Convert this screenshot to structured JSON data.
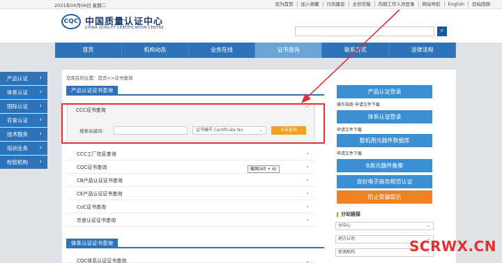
{
  "top": {
    "date": "2021年04月06日 星期二",
    "links": [
      "设为首页",
      "加入收藏",
      "行风建设",
      "主任信箱",
      "内部工作人员登录",
      "网站导航",
      "English",
      "旧站回顾"
    ]
  },
  "logo": {
    "mark": "CQC",
    "cn": "中国质量认证中心",
    "en": "CHINA QUALITY CERTIFICATION CENTRE"
  },
  "search": {
    "icon": "search-icon"
  },
  "nav": [
    "首页",
    "机构动态",
    "业务在线",
    "证书查询",
    "联系方式",
    "法律法规"
  ],
  "sidebar": [
    "产品认证",
    "体系认证",
    "国际认证",
    "农食认证",
    "技术服务",
    "培训业务",
    "检验机构"
  ],
  "main": {
    "breadcrumb": "您现在的位置：首页>>证书查询",
    "section1": "产品认证证书查询",
    "open_item": "CCC证书查询",
    "query": {
      "label": "搜索关键词:",
      "select": "证书编号 Certificate No.",
      "button": "点击查询"
    },
    "items": [
      "CCC工厂信息查询",
      "CQC证书查询",
      "CB产品认证证书查询",
      "CE产品认证证书查询",
      "CoC证书查询",
      "农食认证证书查询"
    ],
    "section2": "体系认证证书查询",
    "section2_first": "CQC体系认证证书查询",
    "tooltip": "截图(Alt + A)"
  },
  "right": {
    "btn1": "产品认证登录",
    "link1": "操作指南  申请文件下载",
    "btn2": "体系认证登录",
    "link2": "申请文件下载",
    "btn3": "整机用元器件数据库",
    "link3": "申请文件下载",
    "btn4": "B类元器件备案",
    "btn5": "良好电子商务规范认证",
    "btn6": "防止受骗提示",
    "sub_title": "分站链接",
    "sel1": "分中心",
    "sel2": "地方公司",
    "sel3": "检测机构"
  },
  "watermark": "SCRWX.CN"
}
